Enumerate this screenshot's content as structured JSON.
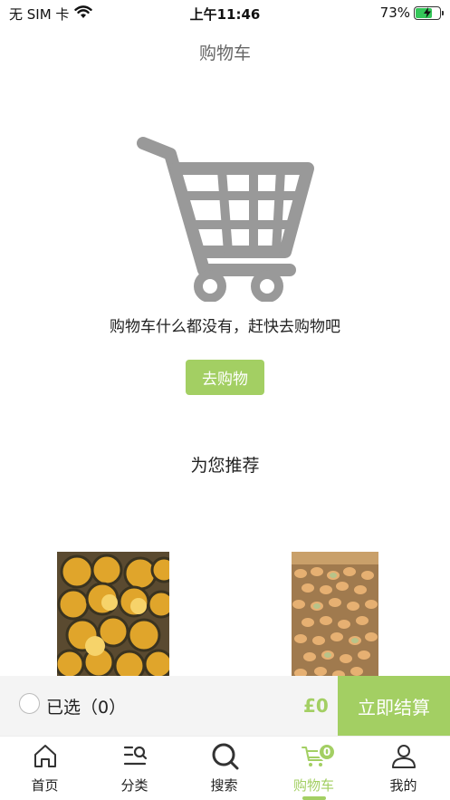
{
  "status_bar": {
    "carrier": "无 SIM 卡",
    "time": "上午11:46",
    "battery": "73%",
    "battery_level": 0.73,
    "wifi_icon": "wifi-icon",
    "charging_icon": "bolt-icon"
  },
  "header": {
    "title": "购物车"
  },
  "empty_state": {
    "icon": "shopping-cart-icon",
    "message": "购物车什么都没有，赶快去购物吧",
    "button_label": "去购物"
  },
  "recommend": {
    "title": "为您推荐",
    "products": [
      {
        "image": "oranges-box-photo"
      },
      {
        "image": "small-fruits-box-photo"
      }
    ]
  },
  "checkout": {
    "selected_label": "已选（0）",
    "total": "£0",
    "button_label": "立即结算"
  },
  "tabs": [
    {
      "label": "首页",
      "icon": "home-icon",
      "active": false
    },
    {
      "label": "分类",
      "icon": "category-icon",
      "active": false
    },
    {
      "label": "搜索",
      "icon": "search-icon",
      "active": false
    },
    {
      "label": "购物车",
      "icon": "cart-icon",
      "active": true,
      "badge": "0"
    },
    {
      "label": "我的",
      "icon": "user-icon",
      "active": false
    }
  ],
  "colors": {
    "accent": "#a3cf63",
    "cart_gray": "#999999",
    "battery_green": "#34c759"
  }
}
